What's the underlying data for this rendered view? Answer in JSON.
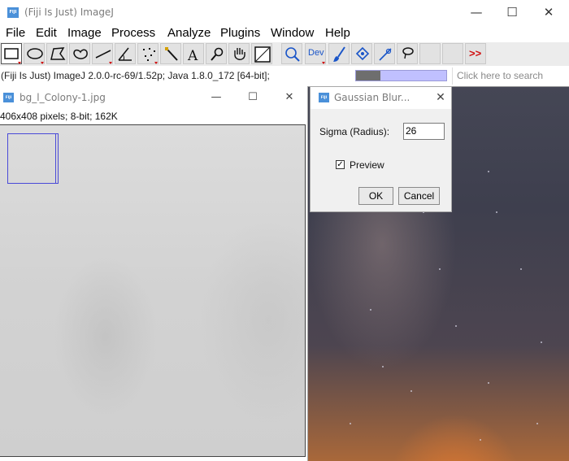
{
  "main_window": {
    "title": "(Fiji Is Just) ImageJ",
    "icon_letters": "FIJI",
    "minimize_glyph": "—",
    "maximize_glyph": "☐",
    "close_glyph": "✕"
  },
  "menu": [
    "File",
    "Edit",
    "Image",
    "Process",
    "Analyze",
    "Plugins",
    "Window",
    "Help"
  ],
  "toolbar": {
    "tools": [
      "rectangle-selection",
      "oval-selection",
      "polygon-selection",
      "freehand-selection",
      "line-selection",
      "angle-tool",
      "multi-point-tool",
      "wand-tool",
      "text-tool",
      "magnifying-glass",
      "scrolling-tool",
      "color-picker",
      "zoom-search",
      "developer-menu",
      "brush-tool",
      "flood-fill",
      "pencil-tool",
      "lasso-tool",
      "empty-slot-1",
      "empty-slot-2",
      "more-tools"
    ],
    "dev_label": "Dev",
    "more_label": ">>"
  },
  "status": {
    "text": "(Fiji Is Just) ImageJ 2.0.0-rc-69/1.52p; Java 1.8.0_172 [64-bit];",
    "progress": 0.27,
    "search_placeholder": "Click here to search"
  },
  "image_window": {
    "title": "bg_l_Colony-1.jpg",
    "info": "406x408 pixels; 8-bit; 162K"
  },
  "dialog": {
    "title": "Gaussian Blur...",
    "sigma_label": "Sigma (Radius):",
    "sigma_value": "26",
    "preview_label": "Preview",
    "preview_checked": true,
    "ok_label": "OK",
    "cancel_label": "Cancel"
  }
}
